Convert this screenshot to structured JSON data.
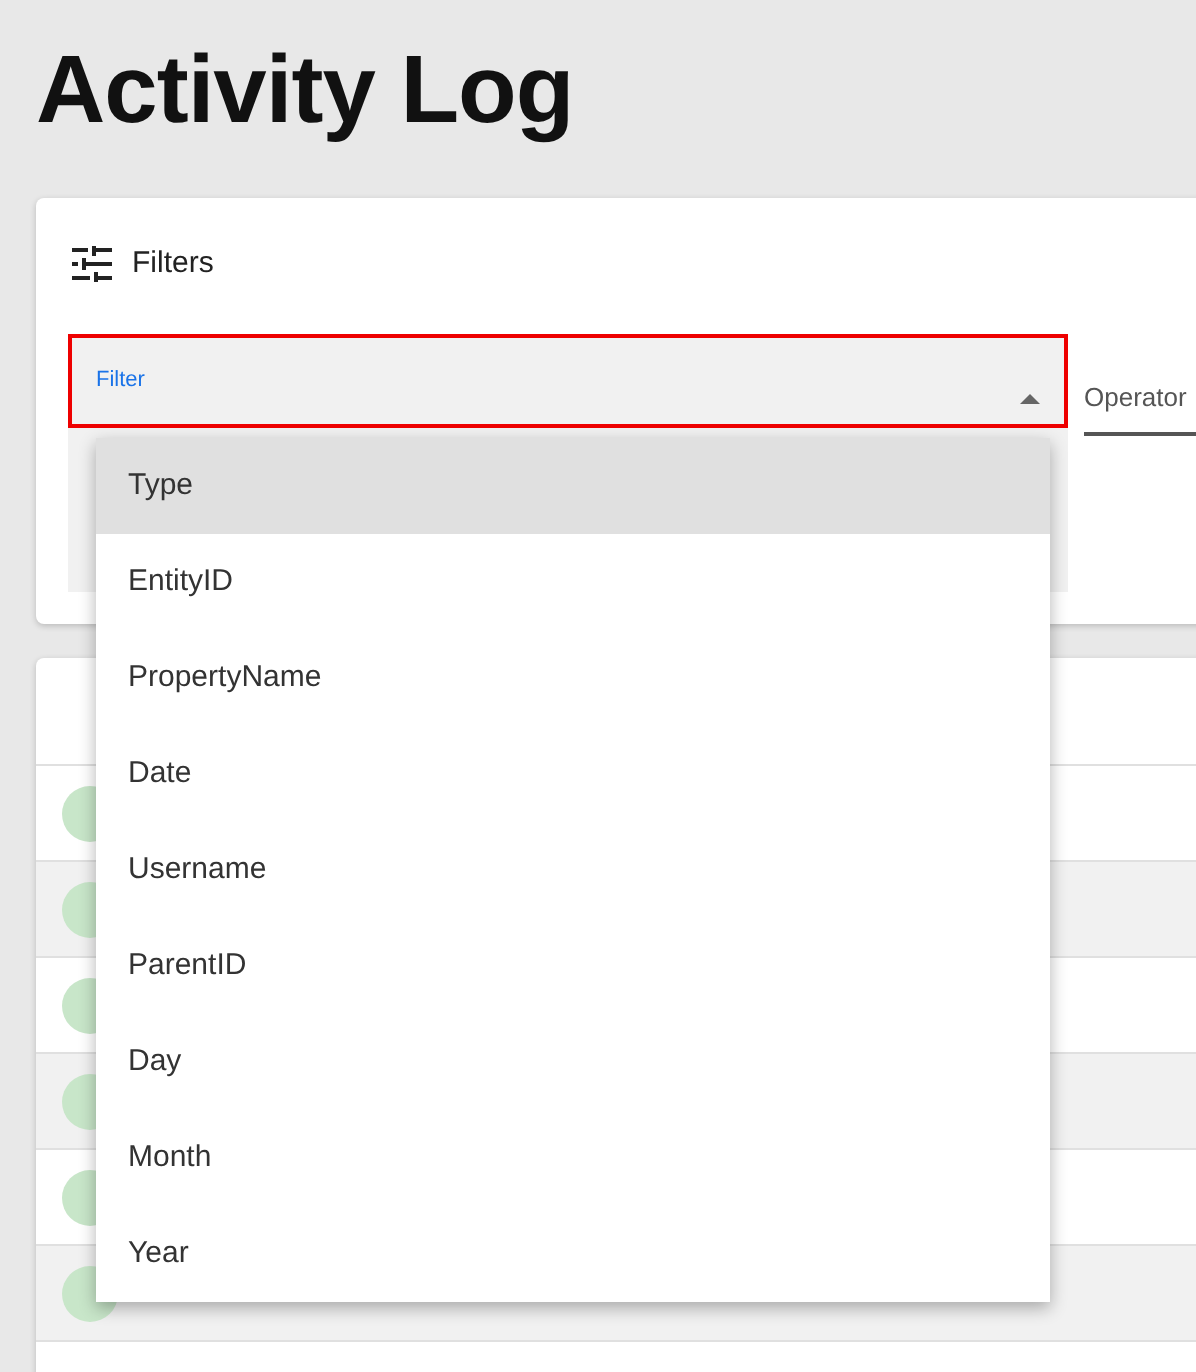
{
  "page_title": "Activity Log",
  "filters": {
    "heading": "Filters",
    "filter_field": {
      "label": "Filter",
      "open": true
    },
    "operator_field": {
      "label": "Operator"
    },
    "options": [
      {
        "label": "Type",
        "selected": true
      },
      {
        "label": "EntityID",
        "selected": false
      },
      {
        "label": "PropertyName",
        "selected": false
      },
      {
        "label": "Date",
        "selected": false
      },
      {
        "label": "Username",
        "selected": false
      },
      {
        "label": "ParentID",
        "selected": false
      },
      {
        "label": "Day",
        "selected": false
      },
      {
        "label": "Month",
        "selected": false
      },
      {
        "label": "Year",
        "selected": false
      }
    ]
  },
  "log_rows": [
    {
      "kind": "avatar"
    },
    {
      "kind": "avatar"
    },
    {
      "kind": "avatar"
    },
    {
      "kind": "avatar"
    },
    {
      "kind": "avatar"
    },
    {
      "kind": "avatar"
    }
  ]
}
